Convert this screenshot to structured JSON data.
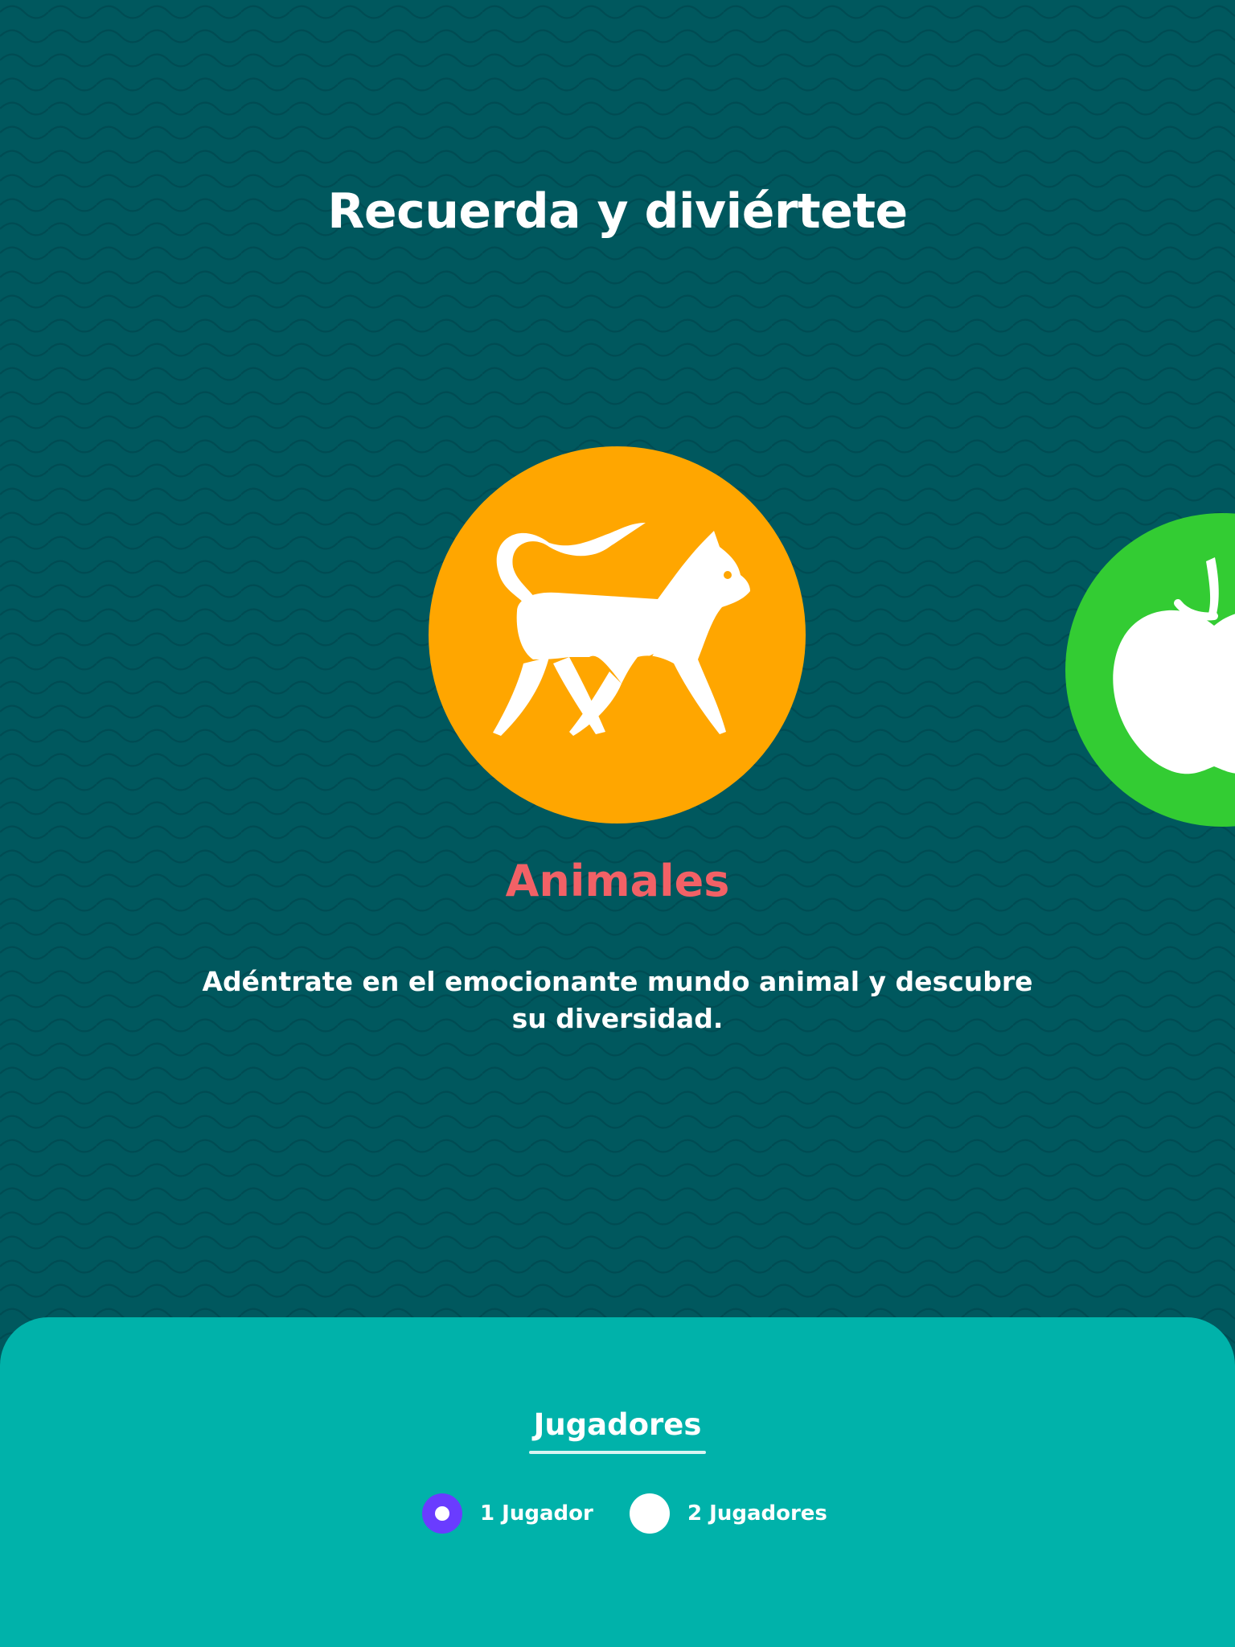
{
  "header": {
    "title": "Recuerda y diviértete"
  },
  "carousel": {
    "cards": [
      {
        "name": "Animales",
        "icon": "cat-icon",
        "color": "#ffa600",
        "active": true
      },
      {
        "name": "",
        "icon": "apple-icon",
        "color": "#33cc33",
        "active": false
      }
    ]
  },
  "category": {
    "title": "Animales",
    "description": "Adéntrate en el emocionante mundo animal y descubre su diversidad."
  },
  "players": {
    "title": "Jugadores",
    "options": [
      {
        "label": "1 Jugador",
        "selected": true
      },
      {
        "label": "2 Jugadores",
        "selected": false
      }
    ]
  },
  "colors": {
    "background": "#00585e",
    "panel": "#00b2aa",
    "accent_title": "#f26166",
    "radio_selected": "#6a3cff"
  }
}
